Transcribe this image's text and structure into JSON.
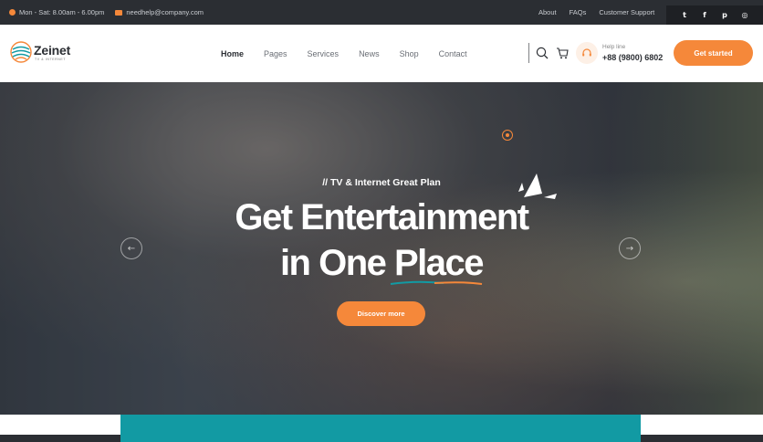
{
  "topbar": {
    "hours": "Mon - Sat: 8.00am - 6.00pm",
    "email": "needhelp@company.com",
    "links": [
      "About",
      "FAQs",
      "Customer Support"
    ],
    "social": [
      {
        "icon": "twitter-icon",
        "glyph": "t"
      },
      {
        "icon": "facebook-icon",
        "glyph": "f"
      },
      {
        "icon": "pinterest-icon",
        "glyph": "p"
      },
      {
        "icon": "instagram-icon",
        "glyph": "◎"
      }
    ]
  },
  "header": {
    "brand": "Zeinet",
    "brand_tagline": "TV & INTERNET",
    "nav": [
      "Home",
      "Pages",
      "Services",
      "News",
      "Shop",
      "Contact"
    ],
    "active_nav": "Home",
    "help_label": "Help line",
    "help_number": "+88 (9800) 6802",
    "cta_label": "Get started"
  },
  "hero": {
    "tagline": "// TV & Internet Great Plan",
    "headline_line1": "Get Entertainment",
    "headline_line2": "in One Place",
    "button_label": "Discover more",
    "prev_arrow": "←",
    "next_arrow": "→"
  },
  "colors": {
    "accent": "#f5883a",
    "dark": "#2b2e33",
    "teal": "#129aa3"
  }
}
